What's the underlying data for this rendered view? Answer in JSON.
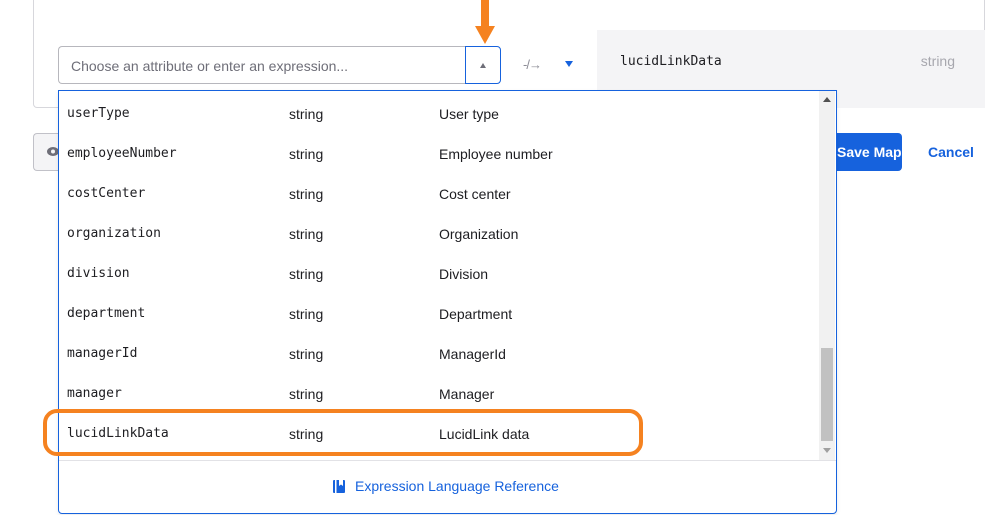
{
  "mapping": {
    "expression_placeholder": "Choose an attribute or enter an expression...",
    "apply_arrow": "-/→",
    "target_attribute": "lucidLinkData",
    "target_type": "string"
  },
  "actions": {
    "save_label": "Save Mappings",
    "cancel_label": "Cancel"
  },
  "dropdown": {
    "rows": [
      {
        "name": "userType",
        "type": "string",
        "label": "User type"
      },
      {
        "name": "employeeNumber",
        "type": "string",
        "label": "Employee number"
      },
      {
        "name": "costCenter",
        "type": "string",
        "label": "Cost center"
      },
      {
        "name": "organization",
        "type": "string",
        "label": "Organization"
      },
      {
        "name": "division",
        "type": "string",
        "label": "Division"
      },
      {
        "name": "department",
        "type": "string",
        "label": "Department"
      },
      {
        "name": "managerId",
        "type": "string",
        "label": "ManagerId"
      },
      {
        "name": "manager",
        "type": "string",
        "label": "Manager"
      },
      {
        "name": "lucidLinkData",
        "type": "string",
        "label": "LucidLink data"
      }
    ],
    "footer_link": "Expression Language Reference",
    "footer_icon": "book-icon",
    "highlighted_row": "lucidLinkData"
  },
  "colors": {
    "accent": "#1662dd",
    "annotation": "#f58220"
  }
}
